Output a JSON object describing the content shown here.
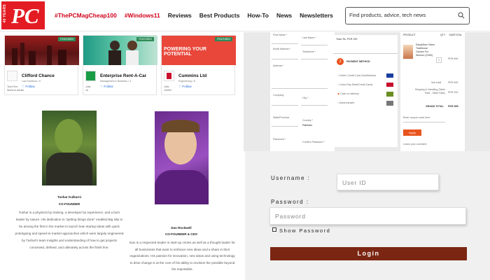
{
  "nav": {
    "logo_years": "40 YEARS",
    "logo_text": "PC",
    "links": [
      "#ThePCMagCheap100",
      "#Windows11",
      "Reviews",
      "Best Products",
      "How-To",
      "News",
      "Newsletters"
    ],
    "search_placeholder": "Find products, advice, tech news"
  },
  "companies": [
    {
      "badge": "FEATURED",
      "name": "Clifford Chance",
      "sub": "Law Solutions • 6",
      "follow": "Follow",
      "meta1": "Tech Firm",
      "meta2": "World to Advise"
    },
    {
      "badge": "FEATURED",
      "name": "Enterprise Rent-A-Car",
      "sub": "Management & Business • 3",
      "follow": "Follow",
      "meta1": "Jobs",
      "meta2": "16"
    },
    {
      "badge": "FEATURED",
      "banner": "POWERING YOUR POTENTIAL",
      "name": "Cummins Ltd",
      "sub": "Engineering • 8",
      "follow": "Follow",
      "meta1": "Jobs",
      "meta2": "10000+"
    }
  ],
  "founders": [
    {
      "name": "Tushar Kulkarni",
      "role": "CO-FOUNDER",
      "bio": "Tushar is a physicist by training, a developer by experience, and a born leader by nature. His dedication to \"getting things done\" enabled Big Idty to be among the first in the market to launch lean startup ideas with quick prototyping and speed-to-market approaches which were largely engineered by Tushar's team insights and understanding of how to get projects conceived, defined, and ultimately across the finish line."
    },
    {
      "name": "Dan Rockwell",
      "role": "CO-FOUNDER & CEO",
      "bio": "Dan is a respected leader in start-up circles as well as a thought leader for all businesses that want to embrace new ideas and a share in their organizations. His passion for innovation, new ideas and using technology to drive change is at the core of his ability to envision the possible beyond the impossible."
    }
  ],
  "checkout": {
    "fields": [
      "First Name *",
      "Last Name *",
      "Email Address *",
      "Telephone *",
      "Address *",
      "Company",
      "City *",
      "State/Province",
      "Country *",
      "Pakistan",
      "Password *",
      "Confirm Password *"
    ],
    "total_label": "Total: Rs. PKR 290",
    "payment_title": "PAYMENT METHOD",
    "payment_options": [
      "Debit / Credit Card (Visa/Master)",
      "Union Pay Debit/Credit Cards",
      "Cash on delivery",
      "Bank transfer"
    ],
    "cart_headers": [
      "PRODUCT",
      "QTY",
      "SUBTOTAL"
    ],
    "product_name": "EasyMiner Video Traditional Games For Women (2X60)",
    "product_qty": "1",
    "product_price": "PKR 699",
    "subtotal_label": "Sub total",
    "subtotal_value": "PKR 699",
    "shipping_label": "Shipping & Handling (Table Rate - Table Rate)",
    "shipping_value": "PKR 200",
    "grand_label": "GRAND TOTAL",
    "grand_value": "PKR 899",
    "coupon_placeholder": "Enter coupon code here",
    "apply_label": "Apply",
    "comment_label": "Leave your comment"
  },
  "login": {
    "username_label": "Username :",
    "username_placeholder": "User ID",
    "password_label": "Password :",
    "password_placeholder": "Password",
    "show_password_label": "Show Password",
    "login_button": "Login"
  }
}
